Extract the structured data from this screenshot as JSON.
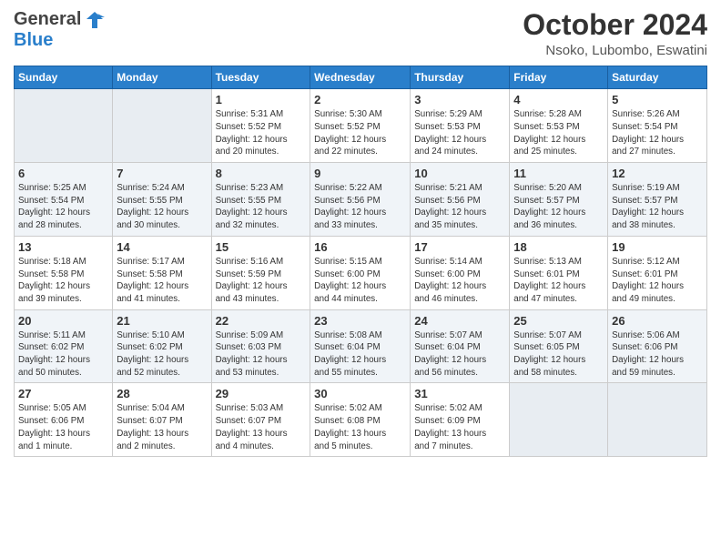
{
  "logo": {
    "general": "General",
    "blue": "Blue"
  },
  "header": {
    "month": "October 2024",
    "location": "Nsoko, Lubombo, Eswatini"
  },
  "weekdays": [
    "Sunday",
    "Monday",
    "Tuesday",
    "Wednesday",
    "Thursday",
    "Friday",
    "Saturday"
  ],
  "weeks": [
    [
      {
        "day": "",
        "info": ""
      },
      {
        "day": "",
        "info": ""
      },
      {
        "day": "1",
        "info": "Sunrise: 5:31 AM\nSunset: 5:52 PM\nDaylight: 12 hours\nand 20 minutes."
      },
      {
        "day": "2",
        "info": "Sunrise: 5:30 AM\nSunset: 5:52 PM\nDaylight: 12 hours\nand 22 minutes."
      },
      {
        "day": "3",
        "info": "Sunrise: 5:29 AM\nSunset: 5:53 PM\nDaylight: 12 hours\nand 24 minutes."
      },
      {
        "day": "4",
        "info": "Sunrise: 5:28 AM\nSunset: 5:53 PM\nDaylight: 12 hours\nand 25 minutes."
      },
      {
        "day": "5",
        "info": "Sunrise: 5:26 AM\nSunset: 5:54 PM\nDaylight: 12 hours\nand 27 minutes."
      }
    ],
    [
      {
        "day": "6",
        "info": "Sunrise: 5:25 AM\nSunset: 5:54 PM\nDaylight: 12 hours\nand 28 minutes."
      },
      {
        "day": "7",
        "info": "Sunrise: 5:24 AM\nSunset: 5:55 PM\nDaylight: 12 hours\nand 30 minutes."
      },
      {
        "day": "8",
        "info": "Sunrise: 5:23 AM\nSunset: 5:55 PM\nDaylight: 12 hours\nand 32 minutes."
      },
      {
        "day": "9",
        "info": "Sunrise: 5:22 AM\nSunset: 5:56 PM\nDaylight: 12 hours\nand 33 minutes."
      },
      {
        "day": "10",
        "info": "Sunrise: 5:21 AM\nSunset: 5:56 PM\nDaylight: 12 hours\nand 35 minutes."
      },
      {
        "day": "11",
        "info": "Sunrise: 5:20 AM\nSunset: 5:57 PM\nDaylight: 12 hours\nand 36 minutes."
      },
      {
        "day": "12",
        "info": "Sunrise: 5:19 AM\nSunset: 5:57 PM\nDaylight: 12 hours\nand 38 minutes."
      }
    ],
    [
      {
        "day": "13",
        "info": "Sunrise: 5:18 AM\nSunset: 5:58 PM\nDaylight: 12 hours\nand 39 minutes."
      },
      {
        "day": "14",
        "info": "Sunrise: 5:17 AM\nSunset: 5:58 PM\nDaylight: 12 hours\nand 41 minutes."
      },
      {
        "day": "15",
        "info": "Sunrise: 5:16 AM\nSunset: 5:59 PM\nDaylight: 12 hours\nand 43 minutes."
      },
      {
        "day": "16",
        "info": "Sunrise: 5:15 AM\nSunset: 6:00 PM\nDaylight: 12 hours\nand 44 minutes."
      },
      {
        "day": "17",
        "info": "Sunrise: 5:14 AM\nSunset: 6:00 PM\nDaylight: 12 hours\nand 46 minutes."
      },
      {
        "day": "18",
        "info": "Sunrise: 5:13 AM\nSunset: 6:01 PM\nDaylight: 12 hours\nand 47 minutes."
      },
      {
        "day": "19",
        "info": "Sunrise: 5:12 AM\nSunset: 6:01 PM\nDaylight: 12 hours\nand 49 minutes."
      }
    ],
    [
      {
        "day": "20",
        "info": "Sunrise: 5:11 AM\nSunset: 6:02 PM\nDaylight: 12 hours\nand 50 minutes."
      },
      {
        "day": "21",
        "info": "Sunrise: 5:10 AM\nSunset: 6:02 PM\nDaylight: 12 hours\nand 52 minutes."
      },
      {
        "day": "22",
        "info": "Sunrise: 5:09 AM\nSunset: 6:03 PM\nDaylight: 12 hours\nand 53 minutes."
      },
      {
        "day": "23",
        "info": "Sunrise: 5:08 AM\nSunset: 6:04 PM\nDaylight: 12 hours\nand 55 minutes."
      },
      {
        "day": "24",
        "info": "Sunrise: 5:07 AM\nSunset: 6:04 PM\nDaylight: 12 hours\nand 56 minutes."
      },
      {
        "day": "25",
        "info": "Sunrise: 5:07 AM\nSunset: 6:05 PM\nDaylight: 12 hours\nand 58 minutes."
      },
      {
        "day": "26",
        "info": "Sunrise: 5:06 AM\nSunset: 6:06 PM\nDaylight: 12 hours\nand 59 minutes."
      }
    ],
    [
      {
        "day": "27",
        "info": "Sunrise: 5:05 AM\nSunset: 6:06 PM\nDaylight: 13 hours\nand 1 minute."
      },
      {
        "day": "28",
        "info": "Sunrise: 5:04 AM\nSunset: 6:07 PM\nDaylight: 13 hours\nand 2 minutes."
      },
      {
        "day": "29",
        "info": "Sunrise: 5:03 AM\nSunset: 6:07 PM\nDaylight: 13 hours\nand 4 minutes."
      },
      {
        "day": "30",
        "info": "Sunrise: 5:02 AM\nSunset: 6:08 PM\nDaylight: 13 hours\nand 5 minutes."
      },
      {
        "day": "31",
        "info": "Sunrise: 5:02 AM\nSunset: 6:09 PM\nDaylight: 13 hours\nand 7 minutes."
      },
      {
        "day": "",
        "info": ""
      },
      {
        "day": "",
        "info": ""
      }
    ]
  ]
}
